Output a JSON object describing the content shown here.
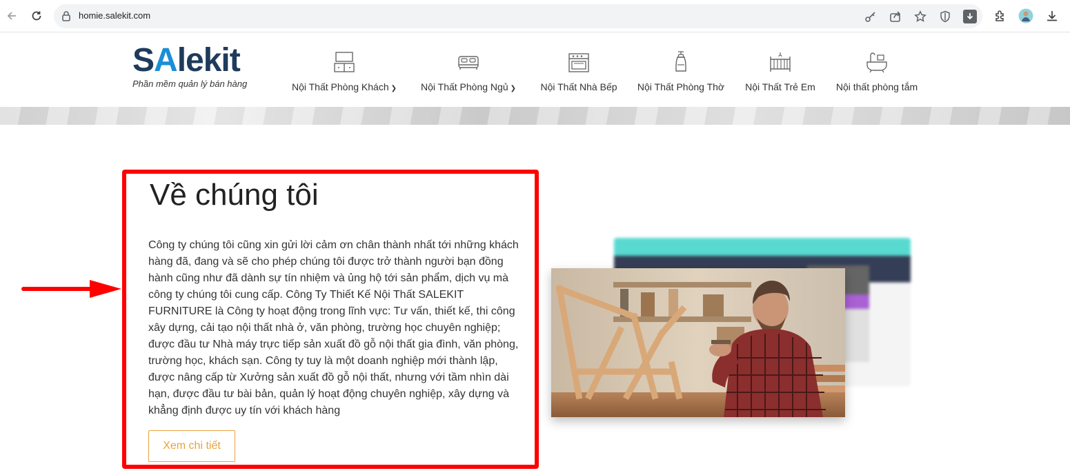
{
  "browser": {
    "url": "homie.salekit.com"
  },
  "logo": {
    "brand_s": "S",
    "brand_a": "A",
    "brand_rest": "lekit",
    "tagline": "Phần mềm quản lý bán hàng"
  },
  "menu": [
    {
      "label": "Nội Thất Phòng Khách",
      "has_dropdown": true,
      "icon": "living-room-icon"
    },
    {
      "label": "Nội Thất Phòng Ngủ",
      "has_dropdown": true,
      "icon": "bed-icon"
    },
    {
      "label": "Nội Thất Nhà Bếp",
      "has_dropdown": false,
      "icon": "stove-icon"
    },
    {
      "label": "Nội Thất Phòng Thờ",
      "has_dropdown": false,
      "icon": "altar-icon"
    },
    {
      "label": "Nội Thất Trẻ Em",
      "has_dropdown": false,
      "icon": "crib-icon"
    },
    {
      "label": "Nội thất phòng tắm",
      "has_dropdown": false,
      "icon": "bathtub-icon"
    }
  ],
  "about": {
    "title": "Về chúng tôi",
    "body": "Công ty chúng tôi cũng xin gửi lời cảm ơn chân thành nhất tới những khách hàng đã, đang và sẽ cho phép chúng tôi được trở thành người bạn đồng hành cũng như đã dành sự tín nhiệm và ủng hộ tới sản phẩm, dịch vụ mà công ty chúng tôi cung cấp. Công Ty Thiết Kế Nội Thất SALEKIT FURNITURE là Công ty hoạt động trong lĩnh vực: Tư vấn, thiết kế, thi công xây dựng, cải tạo nội thất nhà ở, văn phòng, trường học chuyên nghiệp; được đầu tư Nhà máy trực tiếp sản xuất đồ gỗ nội thất gia đình, văn phòng, trường học, khách sạn. Công ty tuy là một doanh nghiệp mới thành lập, được nâng cấp từ Xưởng sản xuất đồ gỗ nội thất, nhưng với tầm nhìn dài hạn, được đầu tư bài bản, quản lý hoạt động chuyên nghiệp, xây dựng và khẳng định được uy tín với khách hàng",
    "button": "Xem chi tiết"
  },
  "colors": {
    "highlight": "#ff0000",
    "accent": "#e8a23a",
    "logo_dark": "#1f3b5c",
    "logo_blue": "#1a8fd6"
  }
}
